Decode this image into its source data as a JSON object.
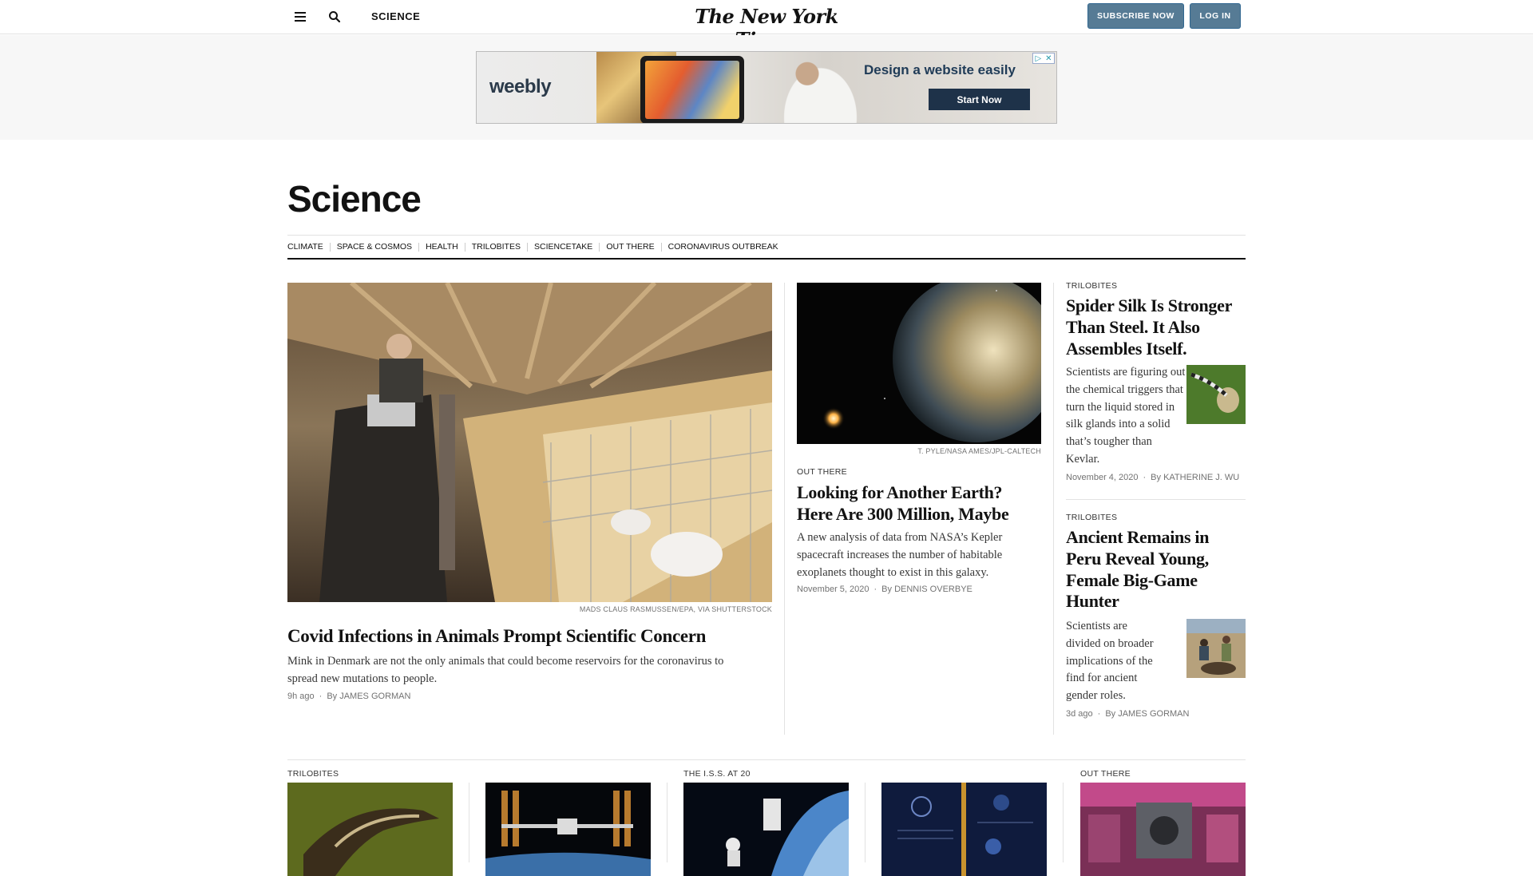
{
  "header": {
    "section_label": "SCIENCE",
    "logo_text": "The New York Times",
    "subscribe_label": "SUBSCRIBE NOW",
    "login_label": "LOG IN"
  },
  "ad": {
    "brand": "weebly",
    "headline": "Design a website easily",
    "cta": "Start Now"
  },
  "page": {
    "title": "Science",
    "subnav": [
      "CLIMATE",
      "SPACE & COSMOS",
      "HEALTH",
      "TRILOBITES",
      "SCIENCETAKE",
      "OUT THERE",
      "CORONAVIRUS OUTBREAK"
    ]
  },
  "lead": {
    "credit": "MADS CLAUS RASMUSSEN/EPA, VIA SHUTTERSTOCK",
    "headline": "Covid Infections in Animals Prompt Scientific Concern",
    "summary": "Mink in Denmark are not the only animals that could become reservoirs for the coronavirus to spread new mutations to people.",
    "time": "9h ago",
    "byline": "By JAMES GORMAN"
  },
  "second": {
    "credit": "T. PYLE/NASA AMES/JPL-CALTECH",
    "kicker": "OUT THERE",
    "headline": "Looking for Another Earth? Here Are 300 Million, Maybe",
    "summary": "A new analysis of data from NASA’s Kepler spacecraft increases the number of habitable exoplanets thought to exist in this galaxy.",
    "time": "November 5, 2020",
    "byline": "By DENNIS OVERBYE"
  },
  "side1": {
    "kicker": "TRILOBITES",
    "headline": "Spider Silk Is Stronger Than Steel. It Also Assembles Itself.",
    "summary": "Scientists are figuring out the chemical triggers that turn the liquid stored in silk glands into a solid that’s tougher than Kevlar.",
    "time": "November 4, 2020",
    "byline": "By KATHERINE J. WU"
  },
  "side2": {
    "kicker": "TRILOBITES",
    "headline": "Ancient Remains in Peru Reveal Young, Female Big-Game Hunter",
    "summary": "Scientists are divided on broader implications of the find for ancient gender roles.",
    "time": "3d ago",
    "byline": "By JAMES GORMAN"
  },
  "bottom": [
    {
      "kicker": "TRILOBITES"
    },
    {
      "kicker": ""
    },
    {
      "kicker": "THE I.S.S. AT 20"
    },
    {
      "kicker": ""
    },
    {
      "kicker": "OUT THERE"
    }
  ],
  "icons": {
    "menu": "menu-icon",
    "search": "search-icon",
    "ad_choices": "ad-choices-icon"
  },
  "colors": {
    "button": "#567b95",
    "ad_cta": "#1e3249"
  }
}
